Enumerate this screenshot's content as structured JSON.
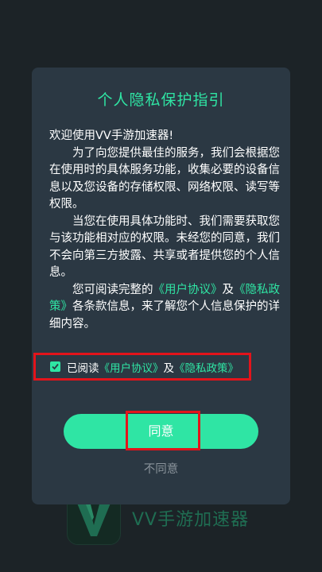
{
  "background": {
    "app_name": "VV手游加速器",
    "logo_icon": "vv-logo-icon"
  },
  "dialog": {
    "title": "个人隐私保护指引",
    "greeting": "欢迎使用VV手游加速器!",
    "paragraph1": "为了向您提供最佳的服务，我们会根据您在使用时的具体服务功能，收集必要的设备信息以及您设备的存储权限、网络权限、读写等权限。",
    "paragraph2": "当您在使用具体功能时、我们需要获取您与该功能相对应的权限。未经您的同意，我们不会向第三方披露、共享或者提供您的个人信息。",
    "paragraph3": {
      "prefix": "您可阅读完整的",
      "user_agreement_link": "《用户协议》",
      "connector": "及",
      "privacy_policy_link": "《隐私政策》",
      "suffix": "各条款信息，来了解您个人信息保护的详细内容。"
    },
    "consent": {
      "checked": true,
      "prefix": "已阅读",
      "user_agreement_link": "《用户协议》",
      "connector": "及",
      "privacy_policy_link": "《隐私政策》"
    },
    "agree_label": "同意",
    "disagree_label": "不同意"
  },
  "colors": {
    "accent": "#2fe5a4",
    "dialog_background": "#2b3843",
    "page_background": "#1c2327",
    "highlight_border": "#e3141b"
  }
}
